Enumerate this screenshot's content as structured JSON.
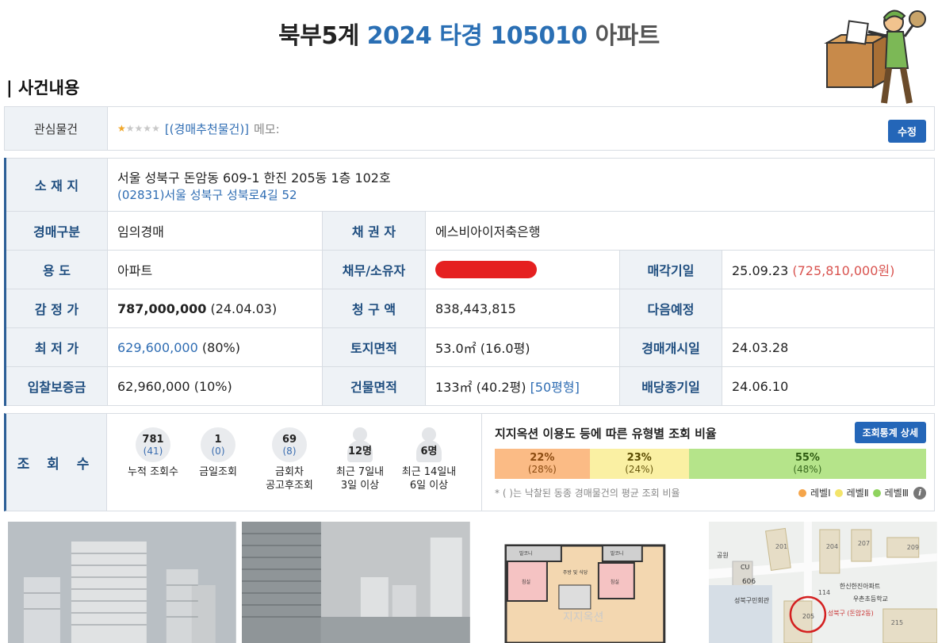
{
  "header": {
    "court": "북부5계",
    "case_number": "2024 타경 105010",
    "property_kind": "아파트"
  },
  "section_title": "| 사건내용",
  "interest": {
    "label": "관심물건",
    "stars_filled": 1,
    "stars_total": 5,
    "recommend_link": "[(경매추천물건)]",
    "memo_label": "메모:",
    "edit_button": "수정"
  },
  "info": {
    "location_label": "소 재 지",
    "address": "서울 성북구 돈암동 609-1 한진 205동 1층 102호",
    "road_address": "(02831)서울 성북구  성북로4길  52",
    "auction_type_label": "경매구분",
    "auction_type": "임의경매",
    "creditor_label": "채 권 자",
    "creditor": "에스비아이저축은행",
    "usage_label": "용         도",
    "usage": "아파트",
    "debtor_label": "채무/소유자",
    "sale_date_label": "매각기일",
    "sale_date": "25.09.23",
    "sale_price": "(725,810,000원)",
    "appraisal_label": "감 정 가",
    "appraisal_value": "787,000,000",
    "appraisal_date": "(24.04.03)",
    "claim_label": "청 구 액",
    "claim_value": "838,443,815",
    "next_schedule_label": "다음예정",
    "next_schedule": "",
    "min_price_label": "최 저 가",
    "min_price": "629,600,000",
    "min_price_pct": "(80%)",
    "land_area_label": "토지면적",
    "land_area": "53.0㎡ (16.0평)",
    "start_date_label": "경매개시일",
    "start_date": "24.03.28",
    "deposit_label": "입찰보증금",
    "deposit": "62,960,000 (10%)",
    "building_area_label": "건물면적",
    "building_area": "133㎡ (40.2평)",
    "building_type": "[50평형]",
    "dividend_deadline_label": "배당종기일",
    "dividend_deadline": "24.06.10"
  },
  "views": {
    "label": "조 회 수",
    "counters": [
      {
        "num": "781",
        "sub": "(41)",
        "caption1": "누적 조회수",
        "caption2": ""
      },
      {
        "num": "1",
        "sub": "(0)",
        "caption1": "금일조회",
        "caption2": ""
      },
      {
        "num": "69",
        "sub": "(8)",
        "caption1": "금회차",
        "caption2": "공고후조회"
      },
      {
        "num": "12명",
        "sub": "",
        "caption1": "최근 7일내",
        "caption2": "3일 이상"
      },
      {
        "num": "6명",
        "sub": "",
        "caption1": "최근 14일내",
        "caption2": "6일 이상"
      }
    ],
    "ratio_title": "지지옥션 이용도 등에 따른 유형별 조회 비율",
    "stats_button": "조회통계 상세",
    "segments": [
      {
        "value": "22%",
        "avg": "(28%)"
      },
      {
        "value": "23%",
        "avg": "(24%)"
      },
      {
        "value": "55%",
        "avg": "(48%)"
      }
    ],
    "footnote": "* ( )는 낙찰된 동종 경매물건의 평균 조회 비율",
    "legend": [
      "레벨Ⅰ",
      "레벨Ⅱ",
      "레벨Ⅲ"
    ],
    "colors": {
      "level1": "#f5a54a",
      "level2": "#f3e46a",
      "level3": "#8fd35f"
    }
  },
  "photos": {
    "map_labels": [
      "공원",
      "CU",
      "201",
      "204",
      "207",
      "209",
      "606",
      "114",
      "한신한진아파트",
      "성북구민회관",
      "205",
      "성북구 (돈암2동)",
      "우촌초등학교",
      "215"
    ],
    "floorplan_labels": [
      "발코니",
      "주방 및 식당",
      "발코니",
      "침실",
      "침실"
    ],
    "watermark": "지지옥션"
  }
}
